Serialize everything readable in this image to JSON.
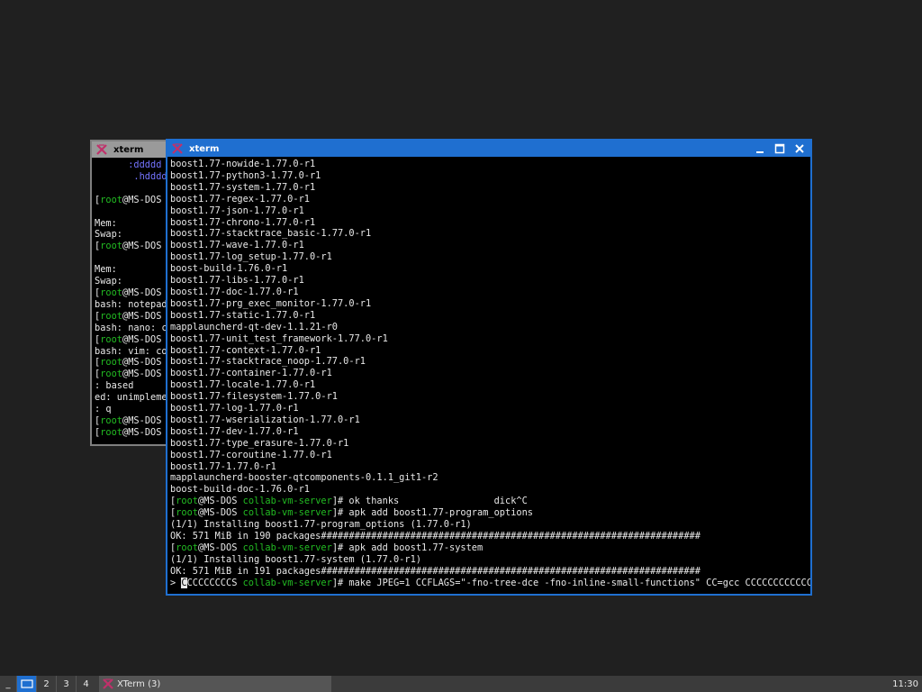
{
  "back_window": {
    "title": "xterm",
    "lines": [
      [
        {
          "t": "      :ddddd",
          "c": "blue"
        }
      ],
      [
        {
          "t": "       .hdddd",
          "c": "blue"
        }
      ],
      [
        {
          "t": ""
        }
      ],
      [
        {
          "t": "[",
          "c": "white"
        },
        {
          "t": "root",
          "c": "green"
        },
        {
          "t": "@MS-DOS",
          "c": "white"
        }
      ],
      [
        {
          "t": ""
        }
      ],
      [
        {
          "t": "Mem:",
          "c": "white"
        }
      ],
      [
        {
          "t": "Swap:",
          "c": "white"
        }
      ],
      [
        {
          "t": "[",
          "c": "white"
        },
        {
          "t": "root",
          "c": "green"
        },
        {
          "t": "@MS-DOS",
          "c": "white"
        }
      ],
      [
        {
          "t": ""
        }
      ],
      [
        {
          "t": "Mem:",
          "c": "white"
        }
      ],
      [
        {
          "t": "Swap:",
          "c": "white"
        }
      ],
      [
        {
          "t": "[",
          "c": "white"
        },
        {
          "t": "root",
          "c": "green"
        },
        {
          "t": "@MS-DOS",
          "c": "white"
        }
      ],
      [
        {
          "t": "bash: notepad",
          "c": "white"
        }
      ],
      [
        {
          "t": "[",
          "c": "white"
        },
        {
          "t": "root",
          "c": "green"
        },
        {
          "t": "@MS-DOS",
          "c": "white"
        }
      ],
      [
        {
          "t": "bash: nano: c",
          "c": "white"
        }
      ],
      [
        {
          "t": "[",
          "c": "white"
        },
        {
          "t": "root",
          "c": "green"
        },
        {
          "t": "@MS-DOS",
          "c": "white"
        }
      ],
      [
        {
          "t": "bash: vim: co",
          "c": "white"
        }
      ],
      [
        {
          "t": "[",
          "c": "white"
        },
        {
          "t": "root",
          "c": "green"
        },
        {
          "t": "@MS-DOS",
          "c": "white"
        }
      ],
      [
        {
          "t": "[",
          "c": "white"
        },
        {
          "t": "root",
          "c": "green"
        },
        {
          "t": "@MS-DOS",
          "c": "white"
        }
      ],
      [
        {
          "t": ": based",
          "c": "white"
        }
      ],
      [
        {
          "t": "ed: unimpleme",
          "c": "white"
        }
      ],
      [
        {
          "t": ": q",
          "c": "white"
        }
      ],
      [
        {
          "t": "[",
          "c": "white"
        },
        {
          "t": "root",
          "c": "green"
        },
        {
          "t": "@MS-DOS",
          "c": "white"
        }
      ],
      [
        {
          "t": "[",
          "c": "white"
        },
        {
          "t": "root",
          "c": "green"
        },
        {
          "t": "@MS-DOS",
          "c": "white"
        }
      ]
    ]
  },
  "front_window": {
    "title": "xterm",
    "lines": [
      [
        {
          "t": "boost1.77-nowide-1.77.0-r1",
          "c": "white"
        }
      ],
      [
        {
          "t": "boost1.77-python3-1.77.0-r1",
          "c": "white"
        }
      ],
      [
        {
          "t": "boost1.77-system-1.77.0-r1",
          "c": "white"
        }
      ],
      [
        {
          "t": "boost1.77-regex-1.77.0-r1",
          "c": "white"
        }
      ],
      [
        {
          "t": "boost1.77-json-1.77.0-r1",
          "c": "white"
        }
      ],
      [
        {
          "t": "boost1.77-chrono-1.77.0-r1",
          "c": "white"
        }
      ],
      [
        {
          "t": "boost1.77-stacktrace_basic-1.77.0-r1",
          "c": "white"
        }
      ],
      [
        {
          "t": "boost1.77-wave-1.77.0-r1",
          "c": "white"
        }
      ],
      [
        {
          "t": "boost1.77-log_setup-1.77.0-r1",
          "c": "white"
        }
      ],
      [
        {
          "t": "boost-build-1.76.0-r1",
          "c": "white"
        }
      ],
      [
        {
          "t": "boost1.77-libs-1.77.0-r1",
          "c": "white"
        }
      ],
      [
        {
          "t": "boost1.77-doc-1.77.0-r1",
          "c": "white"
        }
      ],
      [
        {
          "t": "boost1.77-prg_exec_monitor-1.77.0-r1",
          "c": "white"
        }
      ],
      [
        {
          "t": "boost1.77-static-1.77.0-r1",
          "c": "white"
        }
      ],
      [
        {
          "t": "mapplauncherd-qt-dev-1.1.21-r0",
          "c": "white"
        }
      ],
      [
        {
          "t": "boost1.77-unit_test_framework-1.77.0-r1",
          "c": "white"
        }
      ],
      [
        {
          "t": "boost1.77-context-1.77.0-r1",
          "c": "white"
        }
      ],
      [
        {
          "t": "boost1.77-stacktrace_noop-1.77.0-r1",
          "c": "white"
        }
      ],
      [
        {
          "t": "boost1.77-container-1.77.0-r1",
          "c": "white"
        }
      ],
      [
        {
          "t": "boost1.77-locale-1.77.0-r1",
          "c": "white"
        }
      ],
      [
        {
          "t": "boost1.77-filesystem-1.77.0-r1",
          "c": "white"
        }
      ],
      [
        {
          "t": "boost1.77-log-1.77.0-r1",
          "c": "white"
        }
      ],
      [
        {
          "t": "boost1.77-wserialization-1.77.0-r1",
          "c": "white"
        }
      ],
      [
        {
          "t": "boost1.77-dev-1.77.0-r1",
          "c": "white"
        }
      ],
      [
        {
          "t": "boost1.77-type_erasure-1.77.0-r1",
          "c": "white"
        }
      ],
      [
        {
          "t": "boost1.77-coroutine-1.77.0-r1",
          "c": "white"
        }
      ],
      [
        {
          "t": "boost1.77-1.77.0-r1",
          "c": "white"
        }
      ],
      [
        {
          "t": "mapplauncherd-booster-qtcomponents-0.1.1_git1-r2",
          "c": "white"
        }
      ],
      [
        {
          "t": "boost-build-doc-1.76.0-r1",
          "c": "white"
        }
      ],
      [
        {
          "t": "[",
          "c": "white"
        },
        {
          "t": "root",
          "c": "green"
        },
        {
          "t": "@MS-DOS ",
          "c": "white"
        },
        {
          "t": "collab-vm-server",
          "c": "green"
        },
        {
          "t": "]# ok thanks                 dick^C",
          "c": "white"
        }
      ],
      [
        {
          "t": "[",
          "c": "white"
        },
        {
          "t": "root",
          "c": "green"
        },
        {
          "t": "@MS-DOS ",
          "c": "white"
        },
        {
          "t": "collab-vm-server",
          "c": "green"
        },
        {
          "t": "]# apk add boost1.77-program_options",
          "c": "white"
        }
      ],
      [
        {
          "t": "(1/1) Installing boost1.77-program_options (1.77.0-r1)",
          "c": "white"
        }
      ],
      [
        {
          "t": "OK: 571 MiB in 190 packages####################################################################",
          "c": "white"
        }
      ],
      [
        {
          "t": "[",
          "c": "white"
        },
        {
          "t": "root",
          "c": "green"
        },
        {
          "t": "@MS-DOS ",
          "c": "white"
        },
        {
          "t": "collab-vm-server",
          "c": "green"
        },
        {
          "t": "]# apk add boost1.77-system",
          "c": "white"
        }
      ],
      [
        {
          "t": "(1/1) Installing boost1.77-system (1.77.0-r1)",
          "c": "white"
        }
      ],
      [
        {
          "t": "OK: 571 MiB in 191 packages####################################################################",
          "c": "white"
        }
      ],
      [
        {
          "t": "> ",
          "c": "white"
        },
        {
          "t": "C",
          "c": "cursor"
        },
        {
          "t": "CCCCCCCCS ",
          "c": "white"
        },
        {
          "t": "collab-vm-server",
          "c": "green"
        },
        {
          "t": "]# make JPEG=1 CCFLAGS=\"-fno-tree-dce -fno-inline-small-functions\" CC=gcc CCCCCCCCCCCCC",
          "c": "white"
        }
      ]
    ]
  },
  "taskbar": {
    "menu_label": "_",
    "workspaces": [
      "2",
      "3",
      "4"
    ],
    "task_label": "XTerm (3)",
    "clock": "11:30"
  },
  "colors": {
    "accent": "#1f6fd0",
    "prompt_green": "#22bb22",
    "logo_blue": "#7474ff",
    "text": "#e8e8e8"
  }
}
